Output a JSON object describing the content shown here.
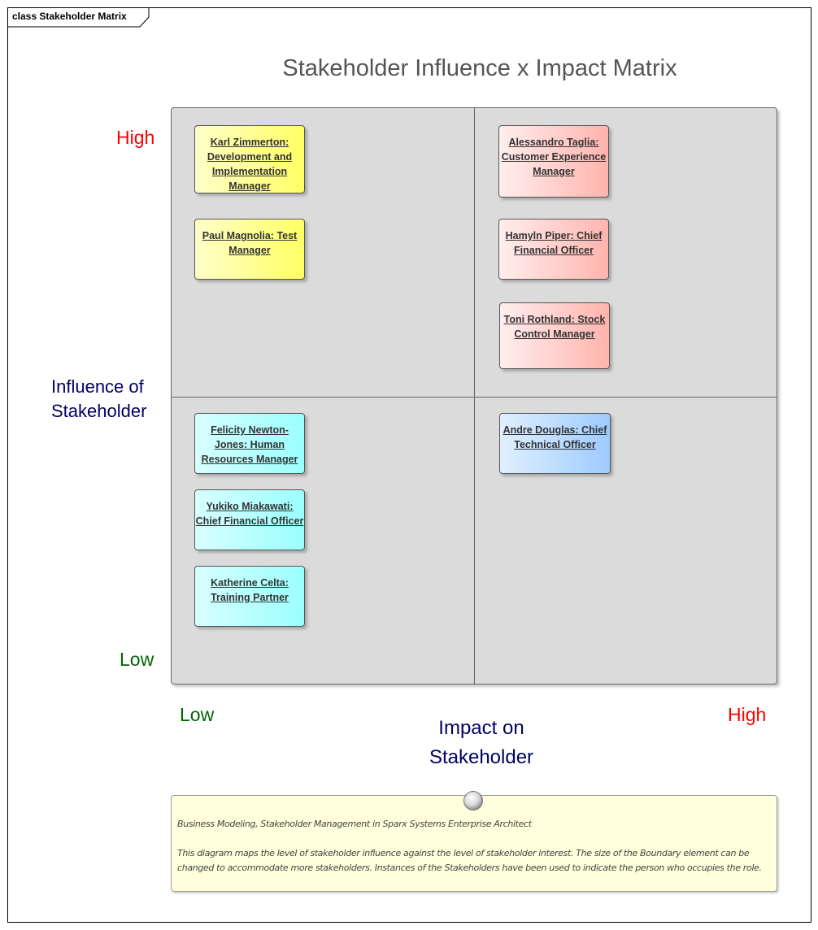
{
  "frame": {
    "label": "class Stakeholder Matrix"
  },
  "title": "Stakeholder Influence x Impact Matrix",
  "y_axis": {
    "title_line1": "Influence of",
    "title_line2": "Stakeholder",
    "high": "High",
    "low": "Low"
  },
  "x_axis": {
    "title_line1": "Impact on",
    "title_line2": "Stakeholder",
    "high": "High",
    "low": "Low"
  },
  "colors": {
    "high_label": "#ff0000",
    "low_label": "#006600",
    "axis_title": "#000066",
    "quadrant_low_impact_high_influence": "#ffff66",
    "quadrant_high_impact_high_influence": "#ffb4ad",
    "quadrant_low_impact_low_influence": "#9bffff",
    "quadrant_high_impact_low_influence": "#9ecbff"
  },
  "quadrants": {
    "top_left": [
      {
        "label": "Karl Zimmerton: Development and Implementation Manager"
      },
      {
        "label": "Paul Magnolia: Test Manager"
      }
    ],
    "top_right": [
      {
        "label": "Alessandro Taglia: Customer Experience Manager"
      },
      {
        "label": "Hamyln Piper: Chief Financial Officer"
      },
      {
        "label": "Toni Rothland: Stock Control Manager"
      }
    ],
    "bottom_left": [
      {
        "label": "Felicity Newton-Jones: Human Resources Manager"
      },
      {
        "label": "Yukiko Miakawati: Chief Financial Officer"
      },
      {
        "label": "Katherine Celta: Training Partner"
      }
    ],
    "bottom_right": [
      {
        "label": "Andre Douglas: Chief Technical Officer"
      }
    ]
  },
  "note": {
    "line1": "Business Modeling, Stakeholder Management in Sparx Systems Enterprise Architect",
    "line2": "This diagram maps the level of stakeholder influence against the level of stakeholder interest. The size of the Boundary element can be changed to accommodate more stakeholders. Instances of the Stakeholders have been used to indicate the person who occupies the role."
  }
}
